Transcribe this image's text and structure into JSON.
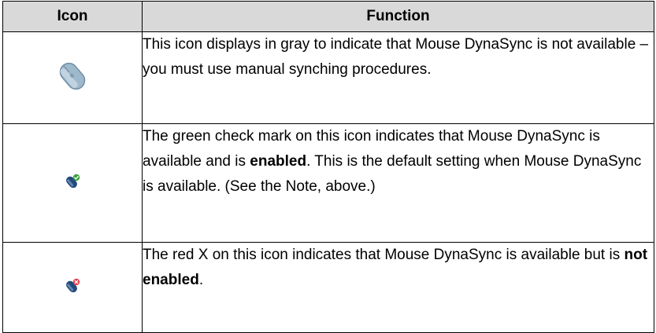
{
  "table": {
    "headers": {
      "icon": "Icon",
      "function": "Function"
    },
    "rows": [
      {
        "icon": "mouse-gray-icon",
        "segments": [
          "This icon displays in gray to indicate that Mouse DynaSync is not available – you must use manual synching procedures."
        ]
      },
      {
        "icon": "mouse-green-check-icon",
        "segments": [
          "The green check mark on this icon indicates that Mouse DynaSync is available and is ",
          "enabled",
          ". This is the default setting when Mouse DynaSync is available. (See the Note, above.)"
        ]
      },
      {
        "icon": "mouse-red-x-icon",
        "segments": [
          "The red X on this icon indicates that Mouse DynaSync is available but is ",
          "not enabled",
          "."
        ]
      }
    ]
  },
  "colors": {
    "header_bg": "#d9d9d9",
    "mouse_gray": "#9fb9cc",
    "mouse_dark": "#244a7a",
    "check_green": "#3aa33a",
    "x_red": "#e8404f"
  }
}
